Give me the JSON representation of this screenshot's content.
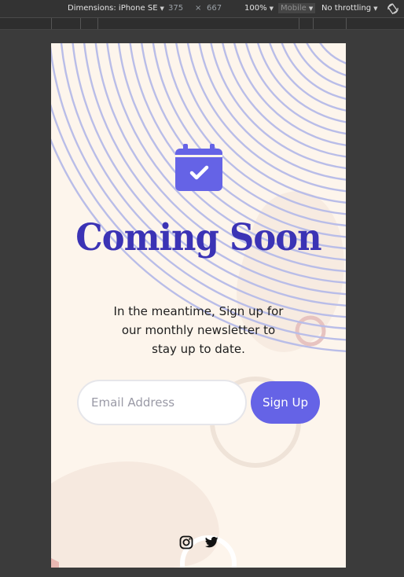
{
  "devtools": {
    "dimensions_label": "Dimensions: iPhone SE",
    "width_value": "375",
    "times": "×",
    "height_value": "667",
    "zoom": "100%",
    "device_type": "Mobile",
    "throttling": "No throttling"
  },
  "page": {
    "title": "Coming Soon",
    "subtitle": "In the meantime, Sign up for our monthly newsletter to stay up to date.",
    "email_placeholder": "Email Address",
    "email_value": "",
    "signup_label": "Sign Up",
    "icons": {
      "calendar": "calendar-check-icon",
      "instagram": "instagram-icon",
      "twitter": "twitter-icon"
    }
  },
  "colors": {
    "page_bg": "#fdf5ec",
    "accent": "#6563e6",
    "title": "#3b33b5",
    "lines": "#b9bde8"
  }
}
